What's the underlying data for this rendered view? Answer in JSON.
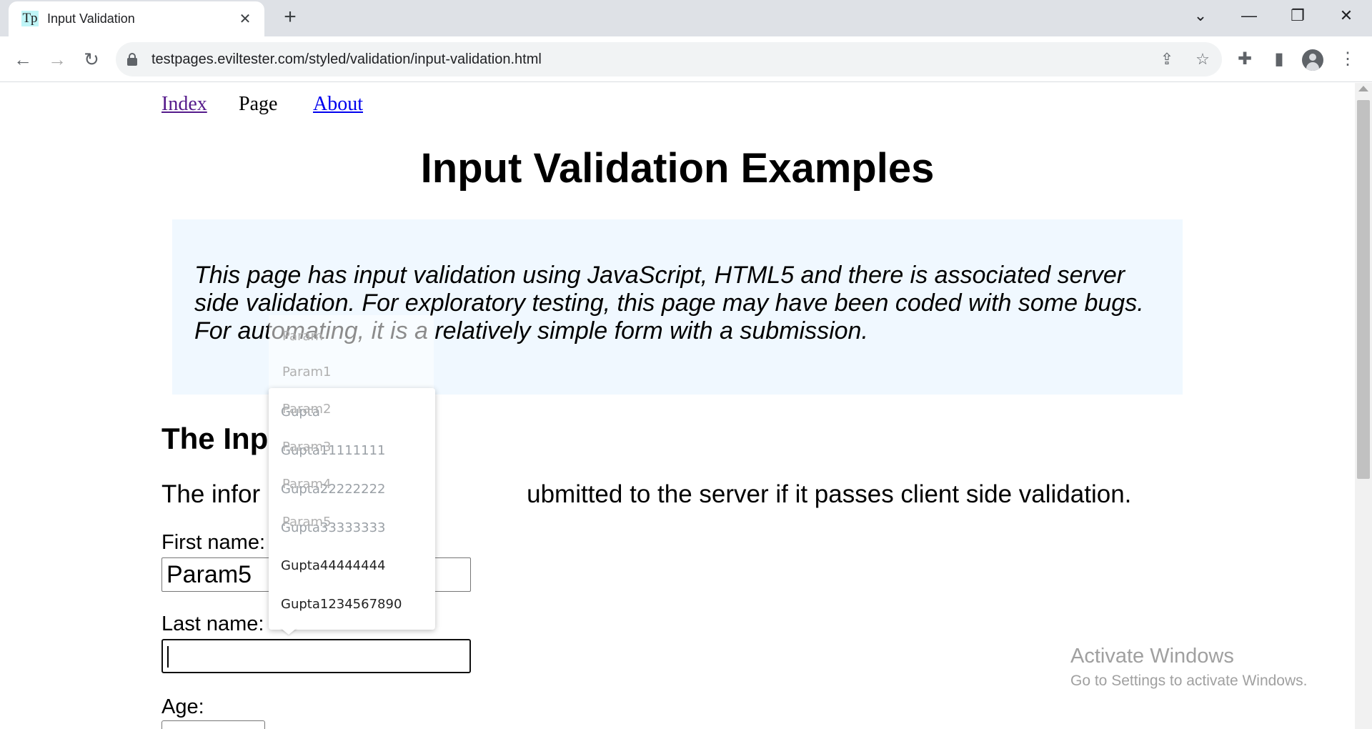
{
  "browser": {
    "tab": {
      "favicon": "Tp",
      "title": "Input Validation",
      "close_glyph": "✕"
    },
    "new_tab_glyph": "+",
    "window_controls": {
      "tab_search": "⌄",
      "minimize": "—",
      "restore": "❐",
      "close": "✕"
    },
    "nav": {
      "back": "←",
      "forward": "→",
      "reload": "↻"
    },
    "url": "testpages.eviltester.com/styled/validation/input-validation.html",
    "omnibox_icons": {
      "share": "⇪",
      "bookmark": "☆"
    },
    "toolbar_icons": {
      "extensions": "✚",
      "side_panel": "▮",
      "menu": "⋮"
    }
  },
  "page": {
    "nav_links": {
      "index": "Index",
      "page": "Page",
      "about": "About"
    },
    "title": "Input Validation Examples",
    "intro": "This page has input validation using JavaScript, HTML5 and there is associated server side validation. For exploratory testing, this page may have been coded with some bugs. For automating, it is a relatively simple form with a submission.",
    "section_title": "The Inp",
    "info_text_left": "The infor",
    "info_text_right": "ubmitted to the server if it passes client side validation.",
    "form": {
      "first_name_label": "First name:",
      "first_name_value": "Param5",
      "last_name_label": "Last name:",
      "last_name_value": "",
      "age_label": "Age:"
    }
  },
  "autocomplete": {
    "faded_items": [
      "Param",
      "Param1",
      "Param2",
      "Param3",
      "Param4",
      "Param5"
    ],
    "items": [
      "Gupta",
      "Gupta11111111",
      "Gupta22222222",
      "Gupta33333333",
      "Gupta44444444",
      "Gupta1234567890"
    ]
  },
  "watermark": {
    "title": "Activate Windows",
    "subtitle": "Go to Settings to activate Windows."
  },
  "colors": {
    "link": "#0000ee",
    "link_visited": "#551a8b",
    "intro_bg": "#f0f8ff",
    "chrome_bg": "#dee1e6"
  }
}
